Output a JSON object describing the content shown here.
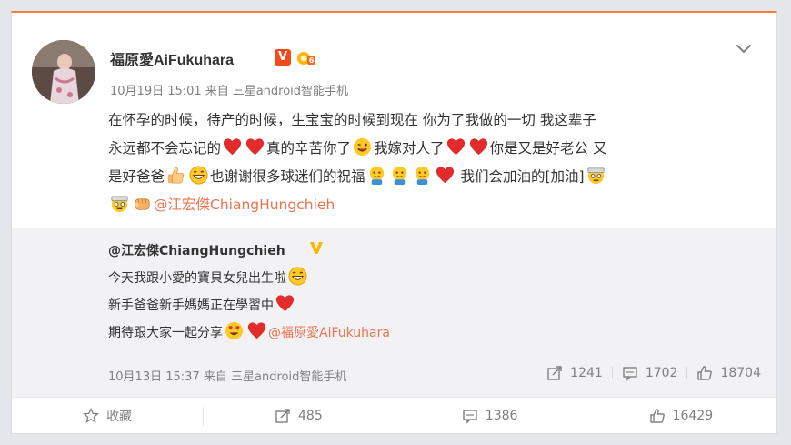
{
  "post": {
    "username": "福原愛AiFukuhara",
    "verified_badge": "V",
    "timestamp": "10月19日 15:01",
    "source_prefix": "来自",
    "source": "三星android智能手机",
    "text_1": "在怀孕的时候，待产的时候，生宝宝的时候到现在 你为了我做的一切 我这辈子",
    "text_2a": "永远都不会忘记的",
    "text_2b": "真的辛苦你了",
    "text_2c": "我嫁对人了",
    "text_2d": "你是又是好老公 又",
    "text_3a": "是好爸爸",
    "text_3b": "也谢谢很多球迷们的祝福",
    "text_3c": "我们会加油的[加油]",
    "mention": "@江宏傑ChiangHungchieh"
  },
  "repost": {
    "username": "@江宏傑ChiangHungchieh",
    "line_1": "今天我跟小愛的寶貝女兒出生啦",
    "line_2": "新手爸爸新手媽媽正在學習中",
    "line_3": "期待跟大家一起分享",
    "mention": "@福原愛AiFukuhara",
    "timestamp": "10月13日 15:37",
    "source_prefix": "来自",
    "source": "三星android智能手机",
    "reposts": "1241",
    "comments": "1702",
    "likes": "18704"
  },
  "actions": {
    "favorite": "收藏",
    "reposts": "485",
    "comments": "1386",
    "likes": "16429"
  },
  "colors": {
    "accent": "#fa7d3c",
    "mention": "#eb7350",
    "meta": "#808080"
  },
  "icons": [
    "chevron-down-icon",
    "verified-v-icon",
    "level-badge-icon",
    "heart-emoji-icon",
    "grin-emoji-icon",
    "thumbs-up-emoji-icon",
    "smile-emoji-icon",
    "fighting-emoji-icon",
    "heart-eyes-emoji-icon",
    "star-icon",
    "repost-icon",
    "comment-icon",
    "like-icon"
  ]
}
